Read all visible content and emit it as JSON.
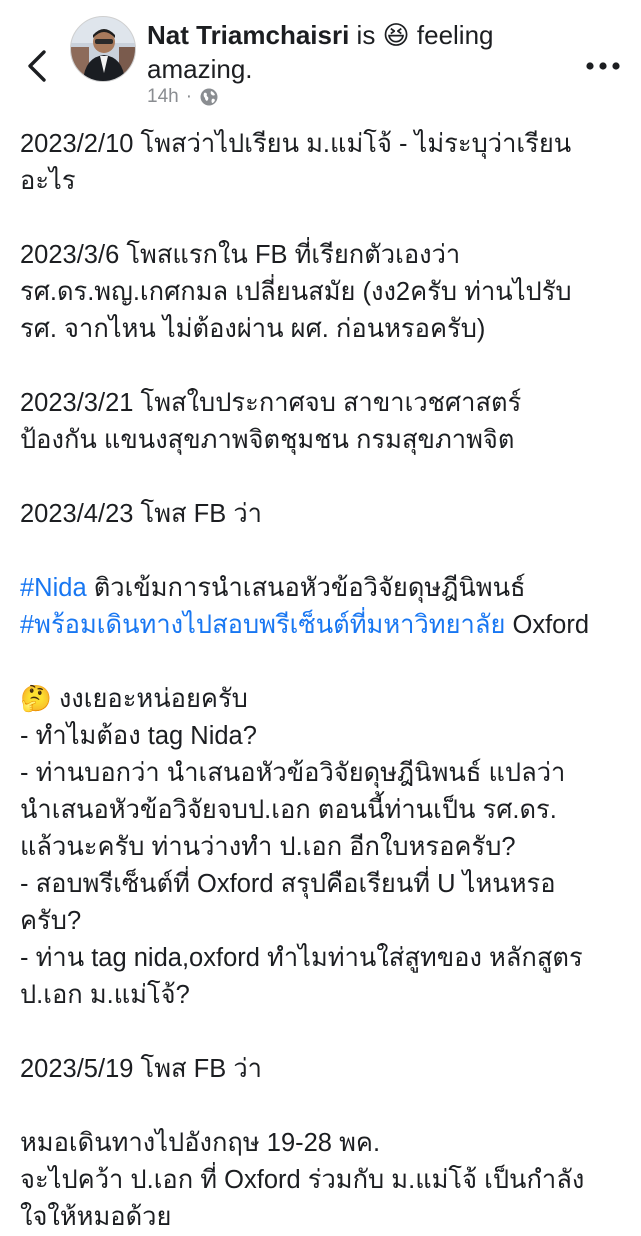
{
  "header": {
    "author_name": "Nat Triamchaisri",
    "status_prefix": " is ",
    "status_emoji": "😆",
    "status_suffix": " feeling",
    "status_line2": "amazing.",
    "time": "14h",
    "audience_icon": "globe-icon",
    "back_icon": "chevron-left-icon",
    "more_icon": "more-horizontal-icon"
  },
  "post": {
    "p1": [
      "2023/2/10 โพสว่าไปเรียน ม.แม่โจ้ - ไม่ระบุว่าเรียน",
      "อะไร"
    ],
    "p2": [
      "2023/3/6 โพสแรกใน FB ที่เรียกตัวเองว่า",
      "รศ.ดร.พญ.เกศกมล เปลี่ยนสมัย (งง2ครับ ท่านไปรับ",
      "รศ. จากไหน ไม่ต้องผ่าน ผศ. ก่อนหรอครับ)"
    ],
    "p3": [
      "2023/3/21 โพสใบประกาศจบ สาขาเวชศาสตร์",
      "ป้องกัน แขนงสุขภาพจิตชุมชน กรมสุขภาพจิต"
    ],
    "p4": "2023/4/23 โพส FB ว่า",
    "hashtag1": "#Nida",
    "hashtag1_after": " ติวเข้มการนำเสนอหัวข้อวิจัยดุษฎีนิพนธ์",
    "hashtag2": "#พร้อมเดินทางไปสอบพรีเซ็นต์ที่มหาวิทยาลัย",
    "hashtag2_after": " Oxford",
    "q_emoji": "🤔",
    "q_title": " งงเยอะหน่อยครับ",
    "q_lines": [
      "- ทำไมต้อง tag Nida?",
      "- ท่านบอกว่า นำเสนอหัวข้อวิจัยดุษฎีนิพนธ์ แปลว่า",
      "นำเสนอหัวข้อวิจัยจบป.เอก ตอนนี้ท่านเป็น รศ.ดร.",
      "แล้วนะครับ ท่านว่างทำ ป.เอก อีกใบหรอครับ?",
      "- สอบพรีเซ็นต์ที่ Oxford สรุปคือเรียนที่ U ไหนหรอ",
      "ครับ?",
      "- ท่าน tag nida,oxford ทำไมท่านใส่สูทของ หลักสูตร",
      "ป.เอก ม.แม่โจ้?"
    ],
    "p5": "2023/5/19 โพส FB ว่า",
    "p6": [
      "หมอเดินทางไปอังกฤษ 19-28 พค.",
      "จะไปคว้า ป.เอก ที่ Oxford ร่วมกับ ม.แม่โจ้ เป็นกำลัง",
      "ใจให้หมอด้วย"
    ]
  }
}
